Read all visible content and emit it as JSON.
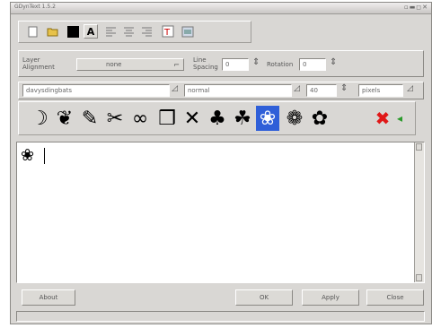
{
  "window": {
    "title": "GDynText 1.5.2",
    "wm_buttons": "▫▬◻✕"
  },
  "toolbar": {
    "icons": [
      "new-icon",
      "open-icon",
      "color-swatch-icon",
      "antialias-icon",
      "align-left-icon",
      "align-center-icon",
      "align-right-icon",
      "font-preview-icon",
      "charmap-icon"
    ],
    "antialias_glyph": "A"
  },
  "layout_row": {
    "layer_alignment_label": "Layer\nAlignment",
    "layer_alignment_value": "none",
    "line_spacing_label": "Line\nSpacing",
    "line_spacing_value": "0",
    "rotation_label": "Rotation",
    "rotation_value": "0"
  },
  "font_row": {
    "font_name": "davysdingbats",
    "font_style": "normal",
    "font_size": "40",
    "size_unit": "pixels"
  },
  "dingbats": {
    "glyphs": [
      "☽",
      "❦",
      "✎",
      "✂",
      "∞",
      "❒",
      "✕",
      "♣",
      "☘",
      "❀",
      "❁",
      "✿"
    ],
    "selected_index": 9,
    "clear_glyph": "✖",
    "more_glyph": "◂"
  },
  "text_area": {
    "content": "❀"
  },
  "buttons": {
    "about": "About",
    "ok": "OK",
    "apply": "Apply",
    "close": "Close"
  }
}
